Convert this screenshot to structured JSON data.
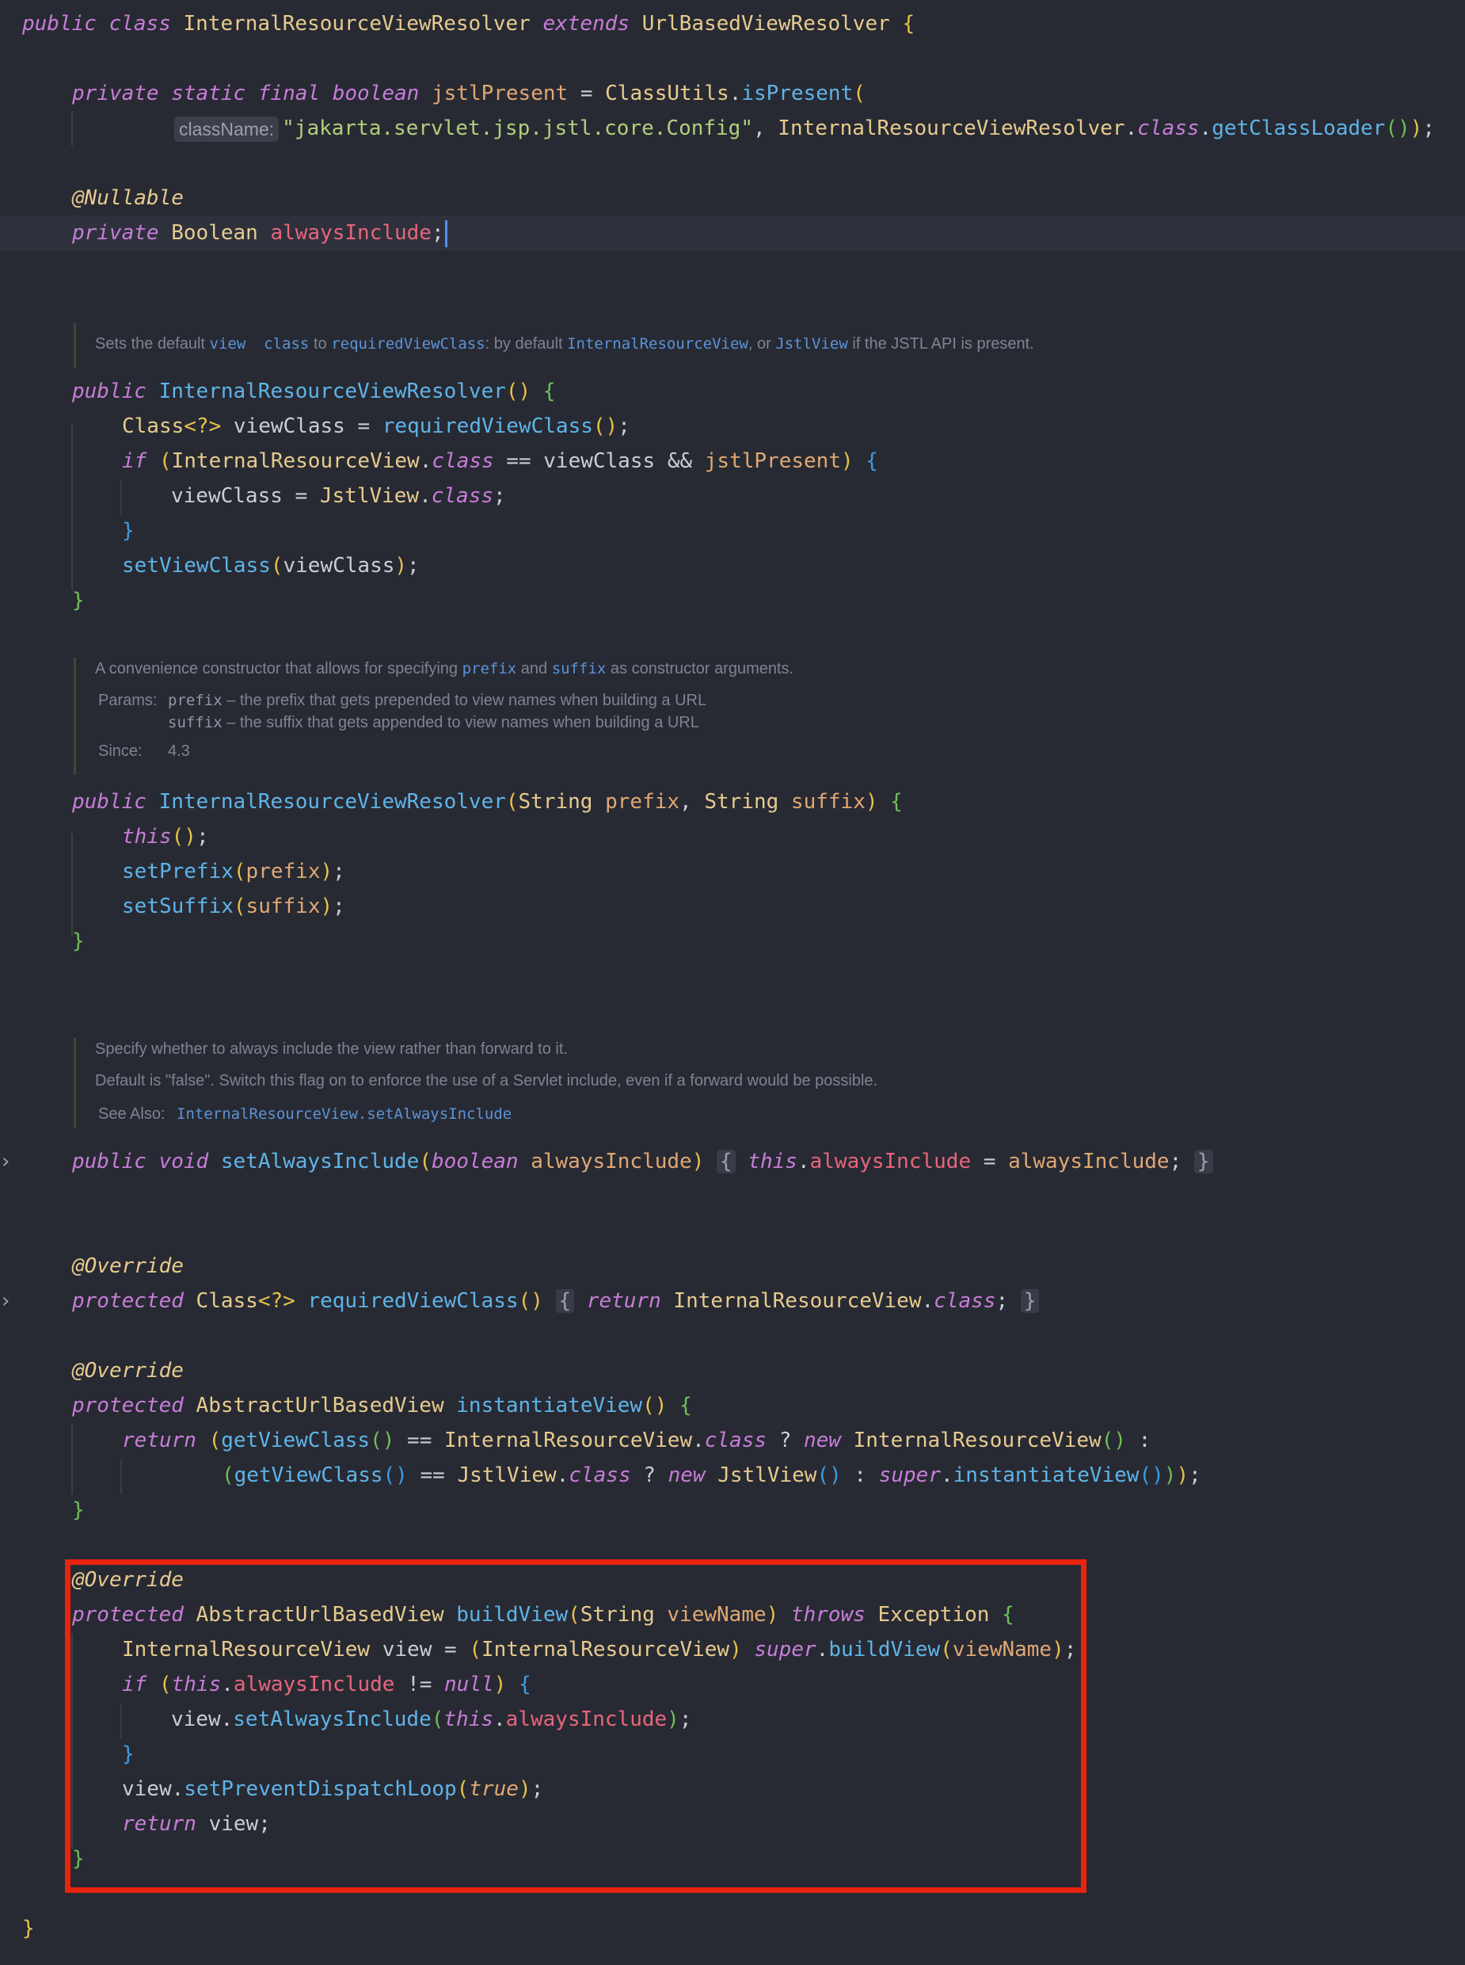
{
  "editor": {
    "param_hint": "className:",
    "hint_color": "#3c3f4a",
    "highlight_color": "#e8230e",
    "fold_marker_icon": "chevron-right-icon"
  },
  "docs": {
    "ctor": {
      "line1": [
        "Sets the default ",
        "view  class",
        " to ",
        "requiredViewClass",
        ": by default ",
        "InternalResourceView",
        ", or ",
        "JstlView",
        " if the JSTL API is present."
      ]
    },
    "ctor2": {
      "line1": [
        "A convenience constructor that allows for specifying ",
        "prefix",
        " and ",
        "suffix",
        " as constructor arguments."
      ],
      "params_label": "Params:",
      "param1": [
        "prefix",
        " – the prefix that gets prepended to view names when building a URL"
      ],
      "param2": [
        "suffix",
        " – the suffix that gets appended to view names when building a URL"
      ],
      "since_label": "Since:",
      "since_value": "4.3"
    },
    "always": {
      "line1": "Specify whether to always include the view rather than forward to it.",
      "line2": "Default is \"false\". Switch this flag on to enforce the use of a Servlet include, even if a forward would be possible.",
      "see_label": "See Also:",
      "see_link": "InternalResourceView.setAlwaysInclude"
    }
  },
  "code": {
    "l1": [
      "public",
      "class",
      "InternalResourceViewResolver",
      "extends",
      "UrlBasedViewResolver",
      "{"
    ],
    "l2": [
      "private",
      "static",
      "final",
      "boolean",
      "jstlPresent",
      "=",
      "ClassUtils",
      ".",
      "isPresent",
      "("
    ],
    "l3": [
      "\"jakarta.servlet.jsp.jstl.core.Config\"",
      ",",
      "InternalResourceViewResolver",
      ".",
      "class",
      ".",
      "getClassLoader",
      "()",
      ")",
      ";"
    ],
    "l4": [
      "@Nullable"
    ],
    "l5": [
      "private",
      "Boolean",
      "alwaysInclude",
      ";"
    ],
    "l6": [
      "public",
      "InternalResourceViewResolver",
      "()",
      "{"
    ],
    "l7": [
      "Class",
      "<?>",
      "viewClass",
      "=",
      "requiredViewClass",
      "()",
      ";"
    ],
    "l8": [
      "if",
      "(",
      "InternalResourceView",
      ".",
      "class",
      "==",
      "viewClass",
      "&&",
      "jstlPresent",
      ")",
      "{"
    ],
    "l9": [
      "viewClass",
      "=",
      "JstlView",
      ".",
      "class",
      ";"
    ],
    "l10": [
      "}"
    ],
    "l11": [
      "setViewClass",
      "(",
      "viewClass",
      ")",
      ";"
    ],
    "l12": [
      "}"
    ],
    "l13": [
      "public",
      "InternalResourceViewResolver",
      "(",
      "String",
      "prefix",
      ",",
      "String",
      "suffix",
      ")",
      "{"
    ],
    "l14": [
      "this",
      "()",
      ";"
    ],
    "l15": [
      "setPrefix",
      "(",
      "prefix",
      ")",
      ";"
    ],
    "l16": [
      "setSuffix",
      "(",
      "suffix",
      ")",
      ";"
    ],
    "l17": [
      "}"
    ],
    "l18": [
      "public",
      "void",
      "setAlwaysInclude",
      "(",
      "boolean",
      "alwaysInclude",
      ")",
      "{",
      "this",
      ".",
      "alwaysInclude",
      "=",
      "alwaysInclude",
      ";",
      "}"
    ],
    "l19": [
      "@Override"
    ],
    "l20": [
      "protected",
      "Class",
      "<?>",
      "requiredViewClass",
      "()",
      "{",
      "return",
      "InternalResourceView",
      ".",
      "class",
      ";",
      "}"
    ],
    "l21": [
      "@Override"
    ],
    "l22": [
      "protected",
      "AbstractUrlBasedView",
      "instantiateView",
      "()",
      "{"
    ],
    "l23": [
      "return",
      "(",
      "getViewClass",
      "()",
      "==",
      "InternalResourceView",
      ".",
      "class",
      "?",
      "new",
      "InternalResourceView",
      "()",
      ":"
    ],
    "l24": [
      "(",
      "getViewClass",
      "()",
      "==",
      "JstlView",
      ".",
      "class",
      "?",
      "new",
      "JstlView",
      "()",
      ":",
      "super",
      ".",
      "instantiateView",
      "()",
      ")",
      ")",
      ";"
    ],
    "l25": [
      "}"
    ],
    "l26": [
      "@Override"
    ],
    "l27": [
      "protected",
      "AbstractUrlBasedView",
      "buildView",
      "(",
      "String",
      "viewName",
      ")",
      "throws",
      "Exception",
      "{"
    ],
    "l28": [
      "InternalResourceView",
      "view",
      "=",
      "(",
      "InternalResourceView",
      ")",
      "super",
      ".",
      "buildView",
      "(",
      "viewName",
      ")",
      ";"
    ],
    "l29": [
      "if",
      "(",
      "this",
      ".",
      "alwaysInclude",
      "!=",
      "null",
      ")",
      "{"
    ],
    "l30": [
      "view",
      ".",
      "setAlwaysInclude",
      "(",
      "this",
      ".",
      "alwaysInclude",
      ")",
      ";"
    ],
    "l31": [
      "}"
    ],
    "l32": [
      "view",
      ".",
      "setPreventDispatchLoop",
      "(",
      "true",
      ")",
      ";"
    ],
    "l33": [
      "return",
      "view",
      ";"
    ],
    "l34": [
      "}"
    ],
    "l35": [
      "}"
    ]
  }
}
